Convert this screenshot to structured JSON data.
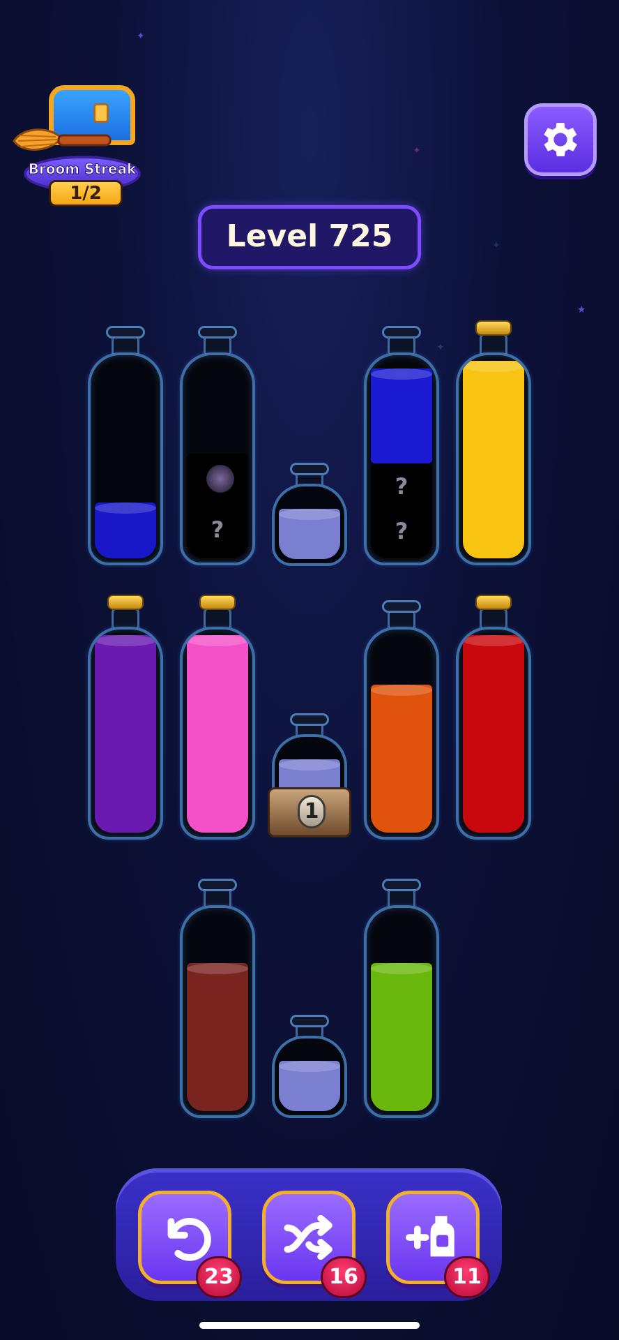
{
  "streak": {
    "label": "Broom Streak",
    "progress": "1/2"
  },
  "level": {
    "label": "Level 725"
  },
  "icons": {
    "settings": "gear-icon",
    "undo": "undo-icon",
    "shuffle": "shuffle-icon",
    "add_bottle": "add-bottle-icon"
  },
  "bottles": {
    "row1": [
      {
        "id": "b1",
        "colors": [
          "#1717c8"
        ],
        "fill": 0.25,
        "corked": false
      },
      {
        "id": "b2",
        "colors": [],
        "hidden_layers": 2,
        "corked": false
      },
      {
        "id": "b3",
        "colors": [
          "#7a7fd0"
        ],
        "fill": 0.6,
        "small": true
      },
      {
        "id": "b4",
        "colors": [
          "#1a1ad2"
        ],
        "fill": 0.4,
        "hidden_layers": 2,
        "corked": false
      },
      {
        "id": "b5",
        "colors": [
          "#f7c411"
        ],
        "fill": 1.0,
        "corked": true
      }
    ],
    "row2": [
      {
        "id": "b6",
        "colors": [
          "#6a1ab0"
        ],
        "fill": 1.0,
        "corked": true
      },
      {
        "id": "b7",
        "colors": [
          "#f451c9"
        ],
        "fill": 1.0,
        "corked": true
      },
      {
        "id": "b8",
        "colors": [
          "#7a7fd0"
        ],
        "fill": 0.6,
        "small": true,
        "locked_moves": "1"
      },
      {
        "id": "b9",
        "colors": [
          "#e0530d"
        ],
        "fill": 0.75,
        "corked": false
      },
      {
        "id": "b10",
        "colors": [
          "#c8080c"
        ],
        "fill": 1.0,
        "corked": true
      }
    ],
    "row3": [
      {
        "id": "b11",
        "colors": [
          "#7a2420"
        ],
        "fill": 0.75,
        "corked": false
      },
      {
        "id": "b12",
        "colors": [
          "#7a7fd0"
        ],
        "fill": 0.6,
        "small": true
      },
      {
        "id": "b13",
        "colors": [
          "#6ab80e"
        ],
        "fill": 0.75,
        "corked": false
      }
    ]
  },
  "hidden_marker": "?",
  "lock_number": "1",
  "tools": {
    "undo": {
      "count": "23"
    },
    "shuffle": {
      "count": "16"
    },
    "add_bottle": {
      "count": "11"
    }
  }
}
